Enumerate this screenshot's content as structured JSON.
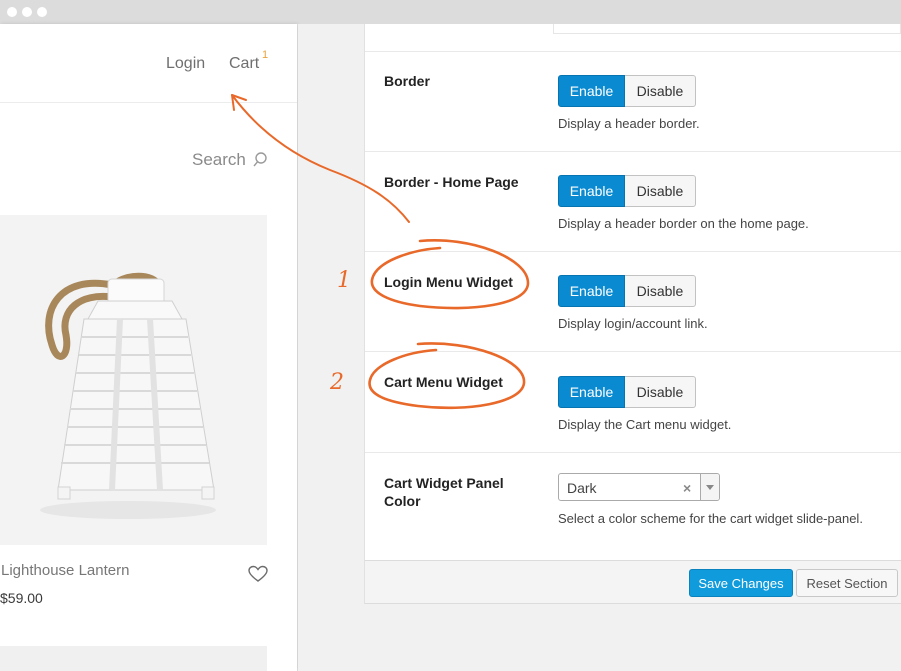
{
  "store": {
    "nav_login": "Login",
    "nav_cart": "Cart",
    "cart_count": "1",
    "search_label": "Search",
    "product_name": "Lighthouse Lantern",
    "product_price": "$59.00"
  },
  "options": {
    "border": {
      "label": "Border",
      "enable": "Enable",
      "disable": "Disable",
      "desc": "Display a header border."
    },
    "border_home": {
      "label": "Border - Home Page",
      "enable": "Enable",
      "disable": "Disable",
      "desc": "Display a header border on the home page."
    },
    "login_widget": {
      "label": "Login Menu Widget",
      "enable": "Enable",
      "disable": "Disable",
      "desc": "Display login/account link."
    },
    "cart_widget": {
      "label": "Cart Menu Widget",
      "enable": "Enable",
      "disable": "Disable",
      "desc": "Display the Cart menu widget."
    },
    "panel_color": {
      "label_line1": "Cart Widget Panel",
      "label_line2": "Color",
      "selected": "Dark",
      "clear_glyph": "×",
      "desc": "Select a color scheme for the cart widget slide-panel."
    }
  },
  "footer": {
    "save": "Save Changes",
    "reset": "Reset Section"
  },
  "annotations": {
    "num1": "1",
    "num2": "2",
    "color": "#e8692a"
  },
  "colors": {
    "accent": "#0a8ad0",
    "save": "#0f9bdc",
    "cart_badge": "#e8a33d"
  },
  "icons": [
    "search-icon",
    "heart-icon",
    "chevron-down-icon",
    "close-icon"
  ]
}
